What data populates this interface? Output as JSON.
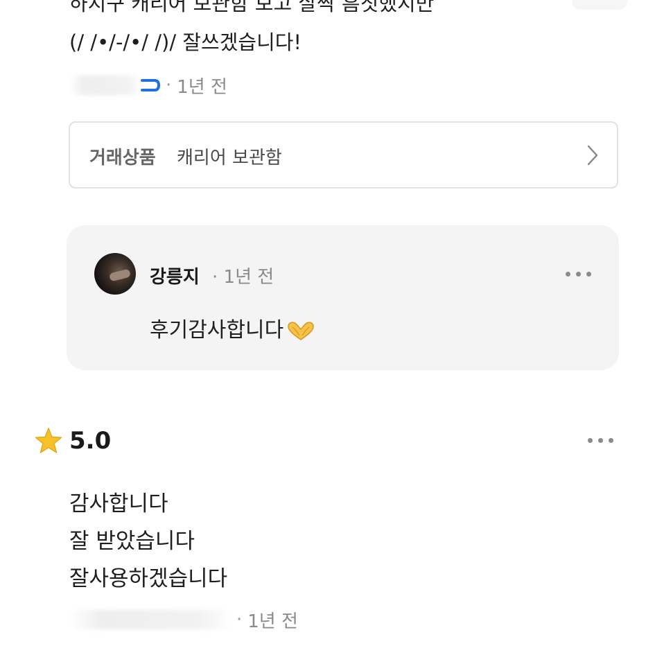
{
  "review_prev": {
    "text_line_cut": "하지구 캐리어 보관함 보고 살짝 흠칫했지만",
    "text_line_2": "(/ /•/-/•/ /)/ 잘쓰겠습니다!",
    "time": "1년 전"
  },
  "product": {
    "label": "거래상품",
    "name": "캐리어 보관함"
  },
  "reply": {
    "author": "강릉지",
    "time": "· 1년 전",
    "text": "후기감사합니다"
  },
  "review": {
    "rating": "5.0",
    "lines": [
      "감사합니다",
      "잘 받았습니다",
      "잘사용하겠습니다"
    ],
    "time": "1년 전"
  },
  "icons": {
    "star": "star-icon",
    "chevron": "chevron-right-icon",
    "more": "more-dots-icon",
    "heart_hands": "heart-hands-emoji"
  },
  "colors": {
    "star": "#F6C22A",
    "reply_bg": "#F4F4F4",
    "border": "#E2E2E2",
    "muted_text": "#8A8A8A",
    "name_tail": "#1E6FE0"
  }
}
